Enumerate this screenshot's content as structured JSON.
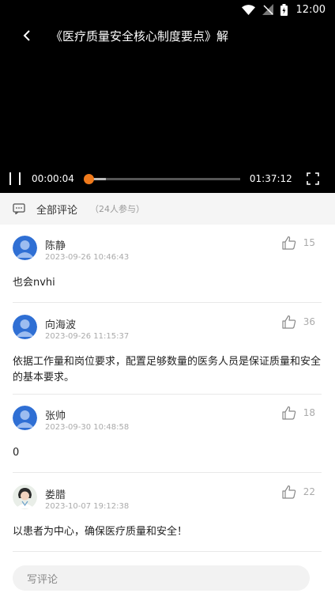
{
  "status_bar": {
    "time": "12:00"
  },
  "player": {
    "title": "《医疗质量安全核心制度要点》解",
    "current_time": "00:00:04",
    "duration": "01:37:12",
    "progress_fraction": 0.0,
    "accent_color": "#f07a1c"
  },
  "comments_header": {
    "label": "全部评论",
    "participants": "（24人参与）"
  },
  "comments": [
    {
      "name": "陈静",
      "date": "2023-09-26 10:46:43",
      "likes": "15",
      "text": "也会nvhi",
      "avatar": "default"
    },
    {
      "name": "向海波",
      "date": "2023-09-26 11:15:37",
      "likes": "36",
      "text": "依据工作量和岗位要求，配置足够数量的医务人员是保证质量和安全的基本要求。",
      "avatar": "default"
    },
    {
      "name": "张帅",
      "date": "2023-09-30 10:48:58",
      "likes": "18",
      "text": "0",
      "avatar": "default"
    },
    {
      "name": "娄腊",
      "date": "2023-10-07 19:12:38",
      "likes": "22",
      "text": "以患者为中心，确保医疗质量和安全！",
      "avatar": "photo"
    }
  ],
  "input": {
    "placeholder": "写评论"
  }
}
